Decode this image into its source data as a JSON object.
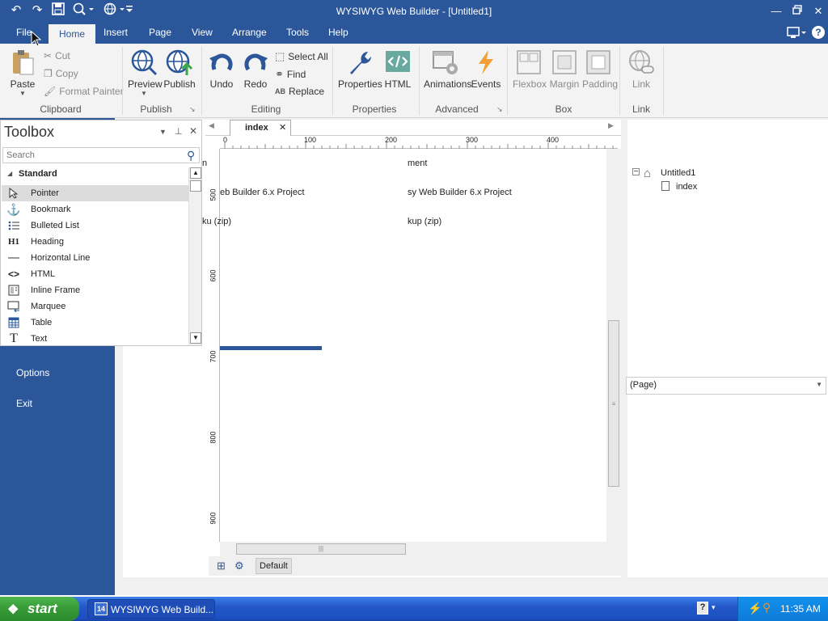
{
  "window": {
    "title": "WYSIWYG Web Builder - [Untitled1]"
  },
  "menu_tabs": [
    {
      "label": "File"
    },
    {
      "label": "Home"
    },
    {
      "label": "Insert"
    },
    {
      "label": "Page"
    },
    {
      "label": "View"
    },
    {
      "label": "Arrange"
    },
    {
      "label": "Tools"
    },
    {
      "label": "Help"
    }
  ],
  "ribbon": {
    "paste": "Paste",
    "cut": "Cut",
    "copy": "Copy",
    "format_painter": "Format Painter",
    "clipboard_group": "Clipboard",
    "preview": "Preview",
    "publish": "Publish",
    "publish_group": "Publish",
    "undo": "Undo",
    "redo": "Redo",
    "select_all": "Select All",
    "find": "Find",
    "replace": "Replace",
    "editing_group": "Editing",
    "properties": "Properties",
    "html": "HTML",
    "properties_group": "Properties",
    "animations": "Animations",
    "events": "Events",
    "advanced_group": "Advanced",
    "flexbox": "Flexbox",
    "margin": "Margin",
    "padding": "Padding",
    "box_group": "Box",
    "link": "Link",
    "link_group": "Link"
  },
  "file_menu": {
    "options": "Options",
    "exit": "Exit"
  },
  "toolbox": {
    "title": "Toolbox",
    "search_placeholder": "Search",
    "section": "Standard",
    "items": [
      {
        "label": "Pointer",
        "icon": "pointer-icon"
      },
      {
        "label": "Bookmark",
        "icon": "anchor-icon"
      },
      {
        "label": "Bulleted List",
        "icon": "list-icon"
      },
      {
        "label": "Heading",
        "icon": "heading-icon"
      },
      {
        "label": "Horizontal Line",
        "icon": "hr-icon"
      },
      {
        "label": "HTML",
        "icon": "code-icon"
      },
      {
        "label": "Inline Frame",
        "icon": "iframe-icon"
      },
      {
        "label": "Marquee",
        "icon": "marquee-icon"
      },
      {
        "label": "Table",
        "icon": "table-icon"
      },
      {
        "label": "Text",
        "icon": "text-icon"
      }
    ]
  },
  "doc_tab": {
    "label": "index"
  },
  "ruler": {
    "top": [
      "0",
      "100",
      "200",
      "300",
      "400"
    ],
    "left": [
      "500",
      "600",
      "700",
      "800",
      "900"
    ]
  },
  "canvas_text": {
    "row1_left": "n",
    "row1_right": "ment",
    "row2_left": "eb Builder 6.x Project",
    "row2_right": "sy Web Builder 6.x Project",
    "row3_left": "ku (zip)",
    "row3_right": "kup (zip)"
  },
  "bottom": {
    "layout_label": "Default"
  },
  "site_tree": {
    "root": "Untitled1",
    "page": "index"
  },
  "properties": {
    "selected": "(Page)"
  },
  "taskbar": {
    "start": "start",
    "task": "WYSIWYG Web Build...",
    "clock": "11:35 AM"
  },
  "colors": {
    "accent": "#2b579a",
    "ribbon_bg": "#f3f3f3",
    "taskbar": "#245edb",
    "start_green": "#3c9a3c"
  }
}
